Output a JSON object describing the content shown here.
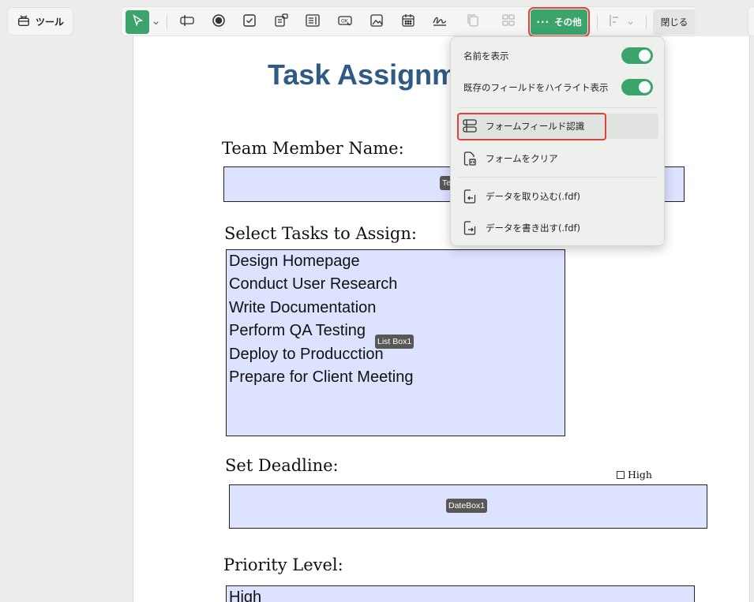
{
  "toolbar": {
    "tools_label": "ツール",
    "more_label": "その他",
    "more_dots": "···",
    "close_label": "閉じる"
  },
  "dropdown": {
    "show_names": "名前を表示",
    "highlight_fields": "既存のフィールドをハイライト表示",
    "form_field_recognition": "フォームフィールド認識",
    "clear_form": "フォームをクリア",
    "import_data": "データを取り込む(.fdf)",
    "export_data": "データを書き出す(.fdf)"
  },
  "document": {
    "title": "Task Assignm",
    "team_member_label": "Team Member Name:",
    "team_member_tag": "Te",
    "tasks_label": "Select Tasks to Assign:",
    "tasks": [
      "Design Homepage",
      "Conduct User Research",
      "Write Documentation",
      "Perform QA Testing",
      "Deploy to Producction",
      "Prepare for Client Meeting"
    ],
    "listbox_tag": "List Box1",
    "deadline_label": "Set Deadline:",
    "datebox_tag": "DateBox1",
    "high_checkbox_label": "High",
    "priority_label": "Priority Level:",
    "priority_value": "High"
  },
  "colors": {
    "accent_green": "#3aa46b",
    "highlight_red": "#e0413a",
    "field_fill": "#dde2ff",
    "title_blue": "#2f5a85"
  }
}
